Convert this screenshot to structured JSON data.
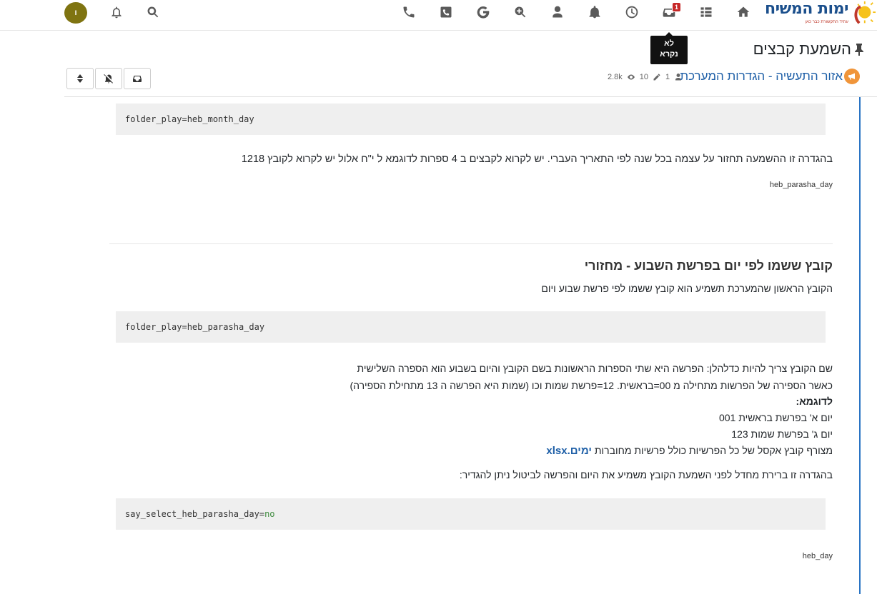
{
  "topbar": {
    "avatar_letter": "ו",
    "unread_badge": "1",
    "logo_title": "ימות המשיח",
    "logo_subtitle": "עתיד התקשורת כבר כאן",
    "icons": [
      "search-icon",
      "bell-icon",
      "user-avatar",
      "phone-icon",
      "phone-square-icon",
      "google-icon",
      "zoom-icon",
      "user-icon",
      "notifications-icon",
      "clock-icon",
      "inbox-icon",
      "list-icon",
      "home-icon"
    ]
  },
  "tooltip": {
    "line1": "לא",
    "line2": "נקרא"
  },
  "page": {
    "title": "השמעת קבצים"
  },
  "topic": {
    "category": "אזור התעשיה - הגדרות המערכת",
    "posters": "1",
    "posts": "10",
    "views": "2.8k"
  },
  "content": {
    "code1": "folder_play=heb_month_day",
    "para1": "בהגדרה זו ההשמעה תחזור על עצמה בכל שנה לפי התאריך העברי. יש לקרוא לקבצים ב 4 ספרות לדוגמא ל י\"ח אלול יש לקרוא לקובץ 1218",
    "label1": "heb_parasha_day",
    "heading": "קובץ ששמו לפי יום בפרשת השבוע - מחזורי",
    "para2": "הקובץ הראשון שהמערכת תשמיע הוא קובץ ששמו לפי פרשת שבוע ויום",
    "code2": "folder_play=heb_parasha_day",
    "line_a": "שם הקובץ צריך להיות כדלהלן: הפרשה היא שתי הספרות הראשונות בשם הקובץ והיום בשבוע הוא הספרה השלישית",
    "line_b": "כאשר הספירה של הפרשות מתחילה מ 00=בראשית. 12=פרשת שמות וכו (שמות היא הפרשה ה 13 מתחילת הספירה)",
    "example_title": "לדוגמא:",
    "example1": "יום א' בפרשת בראשית 001",
    "example2": "יום ג' בפרשת שמות 123",
    "attach_text": "מצורף קובץ אקסל של כל הפרשיות כולל פרשיות מחוברות",
    "attach_link": "ימים.xlsx",
    "para3": "בהגדרה זו ברירת מחדל לפני השמעת הקובץ משמיע את היום והפרשה לביטול ניתן להגדיר:",
    "code3_key": "say_select_heb_parasha_day=",
    "code3_val": "no",
    "label2": "heb_day"
  }
}
